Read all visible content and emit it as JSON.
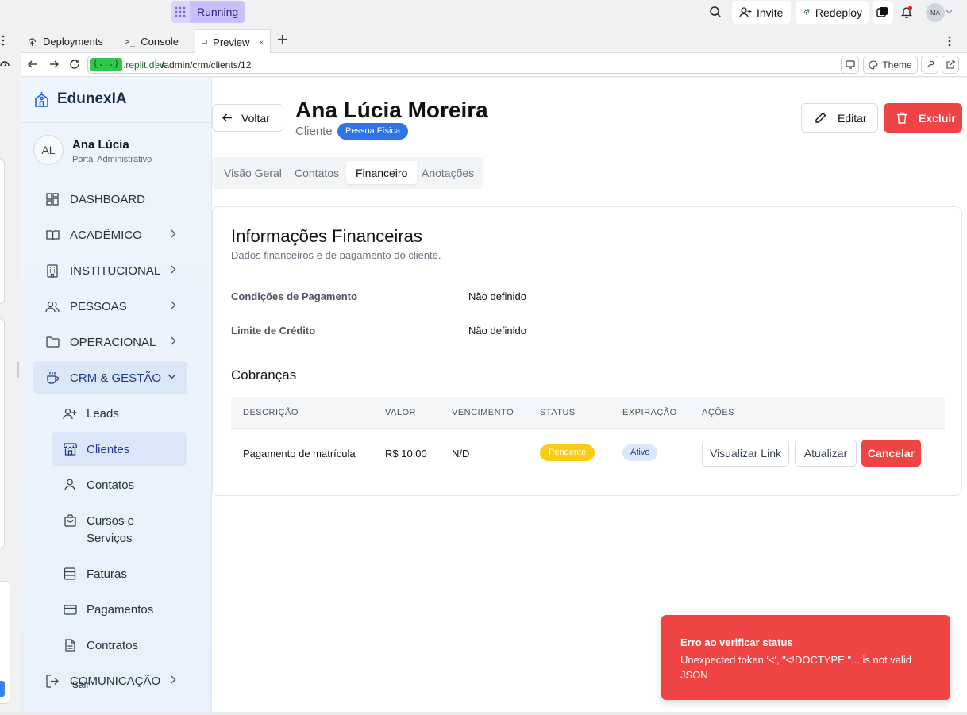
{
  "replit": {
    "run_status": "Running",
    "invite_label": "Invite",
    "redeploy_label": "Redeploy",
    "avatar_initials": "MA",
    "tabs": [
      {
        "label": "Deployments"
      },
      {
        "label": "Console"
      },
      {
        "label": "Preview"
      }
    ],
    "url_host_badge": "{...}",
    "url_host": ".replit.dev",
    "url_path": "/admin/crm/clients/12",
    "theme_label": "Theme"
  },
  "sidebar": {
    "brand": "EdunexIA",
    "user": {
      "initials": "AL",
      "name": "Ana Lúcia",
      "role": "Portal Administrativo"
    },
    "nav": [
      {
        "label": "DASHBOARD"
      },
      {
        "label": "ACADÊMICO"
      },
      {
        "label": "INSTITUCIONAL"
      },
      {
        "label": "PESSOAS"
      },
      {
        "label": "OPERACIONAL"
      },
      {
        "label": "CRM & GESTÃO"
      }
    ],
    "sub": [
      {
        "label": "Leads"
      },
      {
        "label": "Clientes"
      },
      {
        "label": "Contatos"
      },
      {
        "label": "Cursos e Serviços"
      },
      {
        "label": "Faturas"
      },
      {
        "label": "Pagamentos"
      },
      {
        "label": "Contratos"
      }
    ],
    "comunicacao": "COMUNICAÇÃO",
    "logout": "Sair"
  },
  "header": {
    "back_label": "Voltar",
    "title": "Ana Lúcia Moreira",
    "subtitle": "Cliente",
    "badge": "Pessoa Física",
    "edit_label": "Editar",
    "delete_label": "Excluir"
  },
  "tabs": [
    {
      "label": "Visão Geral"
    },
    {
      "label": "Contatos"
    },
    {
      "label": "Financeiro"
    },
    {
      "label": "Anotações"
    }
  ],
  "finance": {
    "title": "Informações Financeiras",
    "description": "Dados financeiros e de pagamento do cliente.",
    "rows": [
      {
        "label": "Condições de Pagamento",
        "value": "Não definido"
      },
      {
        "label": "Limite de Crédito",
        "value": "Não definido"
      }
    ],
    "charges_title": "Cobranças",
    "columns": [
      "DESCRIÇÃO",
      "VALOR",
      "VENCIMENTO",
      "STATUS",
      "EXPIRAÇÃO",
      "AÇÕES"
    ],
    "charges": [
      {
        "description": "Pagamento de matrícula",
        "value": "R$ 10.00",
        "due": "N/D",
        "status": "Pendente",
        "expiration": "Ativo",
        "actions": [
          "Visualizar Link",
          "Atualizar",
          "Cancelar"
        ]
      }
    ]
  },
  "toast": {
    "title": "Erro ao verificar status",
    "message": "Unexpected token '<', \"<!DOCTYPE \"... is not valid JSON"
  },
  "colors": {
    "primary_red": "#ef4444",
    "badge_blue": "#2d74e8",
    "status_yellow": "#facc15",
    "active_nav": "#dbe7f8",
    "run_purple": "#c9c1fb"
  }
}
